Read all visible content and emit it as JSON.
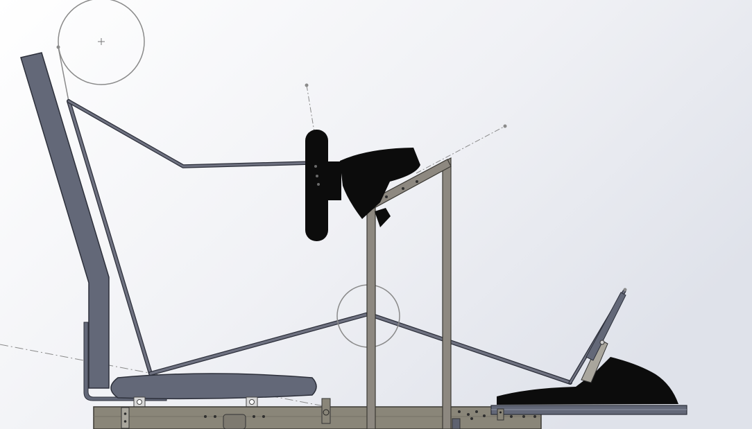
{
  "scene": {
    "background": {
      "light": "#ffffff",
      "shade": "#dfe2ea"
    },
    "colors": {
      "seat": "#636878",
      "seat_edge": "#2c2f3a",
      "frame": "#8d8880",
      "frame_edge": "#3a3833",
      "base": "#8a8679",
      "skeleton": "#6e7180",
      "construction": "#8a8a8a",
      "black_part": "#0c0c0c",
      "hole": "#2e2e2e"
    }
  }
}
